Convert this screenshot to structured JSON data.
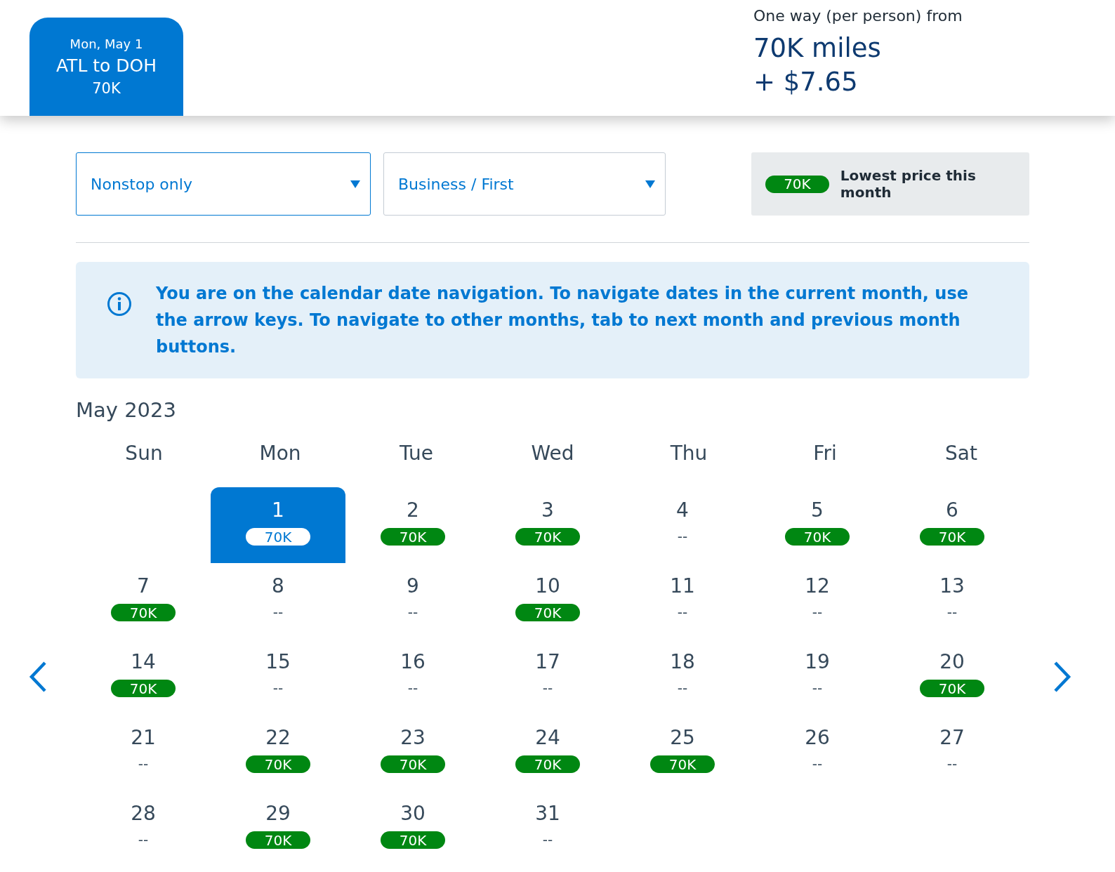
{
  "trip_tab": {
    "date": "Mon, May 1",
    "route": "ATL to DOH",
    "price": "70K",
    "selected": true
  },
  "fare_summary": {
    "label": "One way (per person) from",
    "miles": "70K miles",
    "taxes": "+ $7.65"
  },
  "filters": [
    {
      "value": "Nonstop only",
      "focused": true
    },
    {
      "value": "Business / First",
      "focused": false
    }
  ],
  "legend": {
    "badge": "70K",
    "text": "Lowest price this month"
  },
  "info_banner": "You are on the calendar date navigation. To navigate dates in the current month, use the arrow keys. To navigate to other months, tab to next month and previous month buttons.",
  "calendar": {
    "month": "May 2023",
    "weekdays": [
      "Sun",
      "Mon",
      "Tue",
      "Wed",
      "Thu",
      "Fri",
      "Sat"
    ],
    "weeks": [
      [
        {
          "kind": "blank"
        },
        {
          "kind": "day",
          "day": "1",
          "price": "70K",
          "available": true,
          "selected": true
        },
        {
          "kind": "day",
          "day": "2",
          "price": "70K",
          "available": true,
          "selected": false
        },
        {
          "kind": "day",
          "day": "3",
          "price": "70K",
          "available": true,
          "selected": false
        },
        {
          "kind": "day",
          "day": "4",
          "price": "--",
          "available": false,
          "selected": false
        },
        {
          "kind": "day",
          "day": "5",
          "price": "70K",
          "available": true,
          "selected": false
        },
        {
          "kind": "day",
          "day": "6",
          "price": "70K",
          "available": true,
          "selected": false
        }
      ],
      [
        {
          "kind": "day",
          "day": "7",
          "price": "70K",
          "available": true,
          "selected": false
        },
        {
          "kind": "day",
          "day": "8",
          "price": "--",
          "available": false,
          "selected": false
        },
        {
          "kind": "day",
          "day": "9",
          "price": "--",
          "available": false,
          "selected": false
        },
        {
          "kind": "day",
          "day": "10",
          "price": "70K",
          "available": true,
          "selected": false
        },
        {
          "kind": "day",
          "day": "11",
          "price": "--",
          "available": false,
          "selected": false
        },
        {
          "kind": "day",
          "day": "12",
          "price": "--",
          "available": false,
          "selected": false
        },
        {
          "kind": "day",
          "day": "13",
          "price": "--",
          "available": false,
          "selected": false
        }
      ],
      [
        {
          "kind": "day",
          "day": "14",
          "price": "70K",
          "available": true,
          "selected": false
        },
        {
          "kind": "day",
          "day": "15",
          "price": "--",
          "available": false,
          "selected": false
        },
        {
          "kind": "day",
          "day": "16",
          "price": "--",
          "available": false,
          "selected": false
        },
        {
          "kind": "day",
          "day": "17",
          "price": "--",
          "available": false,
          "selected": false
        },
        {
          "kind": "day",
          "day": "18",
          "price": "--",
          "available": false,
          "selected": false
        },
        {
          "kind": "day",
          "day": "19",
          "price": "--",
          "available": false,
          "selected": false
        },
        {
          "kind": "day",
          "day": "20",
          "price": "70K",
          "available": true,
          "selected": false
        }
      ],
      [
        {
          "kind": "day",
          "day": "21",
          "price": "--",
          "available": false,
          "selected": false
        },
        {
          "kind": "day",
          "day": "22",
          "price": "70K",
          "available": true,
          "selected": false
        },
        {
          "kind": "day",
          "day": "23",
          "price": "70K",
          "available": true,
          "selected": false
        },
        {
          "kind": "day",
          "day": "24",
          "price": "70K",
          "available": true,
          "selected": false
        },
        {
          "kind": "day",
          "day": "25",
          "price": "70K",
          "available": true,
          "selected": false
        },
        {
          "kind": "day",
          "day": "26",
          "price": "--",
          "available": false,
          "selected": false
        },
        {
          "kind": "day",
          "day": "27",
          "price": "--",
          "available": false,
          "selected": false
        }
      ],
      [
        {
          "kind": "day",
          "day": "28",
          "price": "--",
          "available": false,
          "selected": false
        },
        {
          "kind": "day",
          "day": "29",
          "price": "70K",
          "available": true,
          "selected": false
        },
        {
          "kind": "day",
          "day": "30",
          "price": "70K",
          "available": true,
          "selected": false
        },
        {
          "kind": "day",
          "day": "31",
          "price": "--",
          "available": false,
          "selected": false
        },
        {
          "kind": "blank"
        },
        {
          "kind": "blank"
        },
        {
          "kind": "blank"
        }
      ]
    ]
  }
}
